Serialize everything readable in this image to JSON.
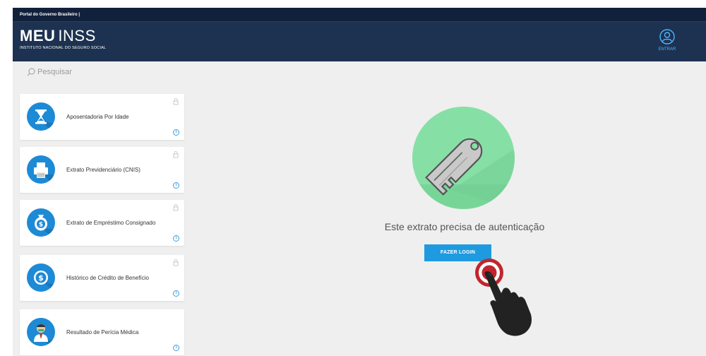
{
  "gov_bar": {
    "text": "Portal do Governo Brasileiro  |"
  },
  "header": {
    "logo_meu": "MEU",
    "logo_inss": "INSS",
    "logo_subtitle": "INSTITUTO NACIONAL DO SEGURO SOCIAL",
    "entrar_label": "ENTRAR"
  },
  "search": {
    "placeholder": "Pesquisar"
  },
  "services": [
    {
      "label": "Aposentadoria Por Idade",
      "icon": "hourglass-icon"
    },
    {
      "label": "Extrato Previdenciário (CNIS)",
      "icon": "printer-icon"
    },
    {
      "label": "Extrato de Empréstimo Consignado",
      "icon": "money-bag-icon"
    },
    {
      "label": "Histórico de Crédito de Benefício",
      "icon": "dollar-coin-icon"
    },
    {
      "label": "Resultado de Perícia Médica",
      "icon": "doctor-icon"
    }
  ],
  "main": {
    "message": "Este extrato precisa de autenticação",
    "login_button": "FAZER LOGIN"
  },
  "colors": {
    "gov_bar": "#12213b",
    "header": "#1d3250",
    "accent": "#1e9be0",
    "key_circle": "#86e0a6",
    "background": "#efefef"
  }
}
